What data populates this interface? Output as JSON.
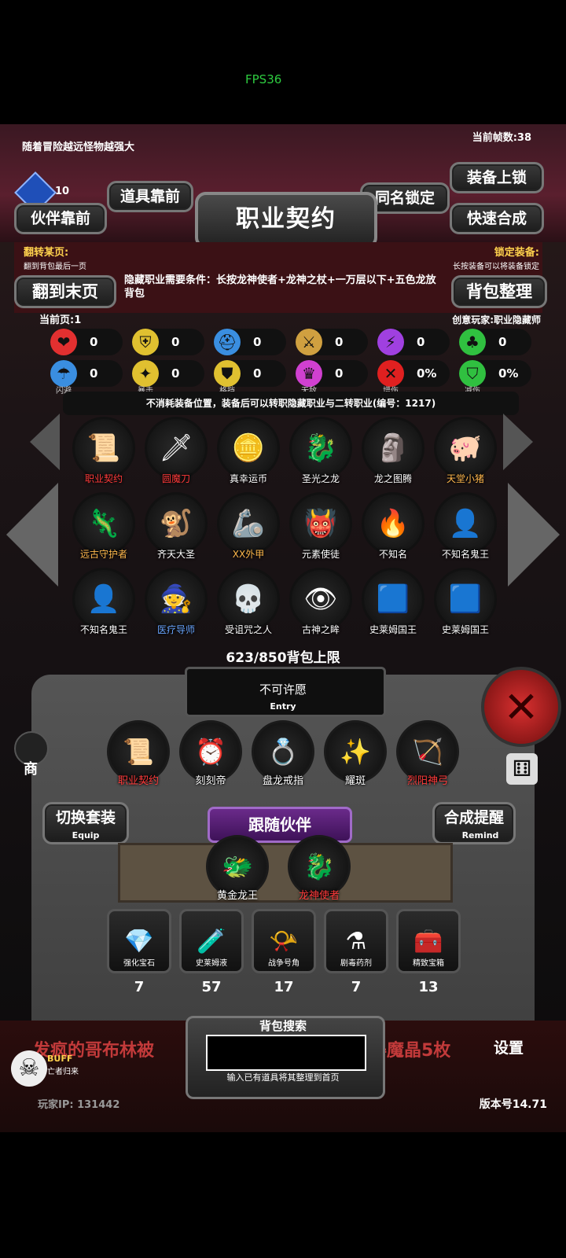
{
  "status_bar": {
    "fps": "FPS36"
  },
  "top": {
    "hint": "随着冒险越远怪物越强大",
    "frame_count": "当前帧数:38",
    "gem_count": "10"
  },
  "buttons": {
    "items_front": "道具靠前",
    "partner_front": "伙伴靠前",
    "same_name_lock": "同名锁定",
    "equip_lock": "装备上锁",
    "quick_synth": "快速合成",
    "goto_last": "翻到末页",
    "bag_sort": "背包整理"
  },
  "title": "职业契约",
  "panel": {
    "flip_title": "翻转某页:",
    "flip_sub": "翻到背包最后一页",
    "lock_title": "锁定装备:",
    "lock_sub": "长按装备可以将装备锁定",
    "hidden_req": "隐藏职业需要条件：长按龙神使者+龙神之杖+一万层以下+五色龙放背包",
    "current_page": "当前页:1",
    "creator": "创意玩家:职业隐藏师"
  },
  "stats_row1": [
    {
      "icon": "heart-icon",
      "glyph": "❤",
      "value": "0"
    },
    {
      "icon": "armor-icon",
      "glyph": "⛨",
      "value": "0"
    },
    {
      "icon": "helmet-icon",
      "glyph": "⛑",
      "value": "0"
    },
    {
      "icon": "sword-icon",
      "glyph": "⚔",
      "value": "0"
    },
    {
      "icon": "lightning-icon",
      "glyph": "⚡",
      "value": "0"
    },
    {
      "icon": "clover-icon",
      "glyph": "♣",
      "value": "0"
    }
  ],
  "stats_row2": [
    {
      "icon": "dodge-icon",
      "glyph": "☂",
      "value": "0",
      "label": "闪避"
    },
    {
      "icon": "crit-icon",
      "glyph": "✦",
      "value": "0",
      "label": "暴击"
    },
    {
      "icon": "block-icon",
      "glyph": "⛊",
      "value": "0",
      "label": "格挡"
    },
    {
      "icon": "invincible-icon",
      "glyph": "♛",
      "value": "0",
      "label": "无敌"
    },
    {
      "icon": "damage-up-icon",
      "glyph": "✕",
      "value": "0%",
      "label": "增伤"
    },
    {
      "icon": "damage-down-icon",
      "glyph": "⛉",
      "value": "0%",
      "label": "减伤"
    }
  ],
  "item_desc": "不消耗装备位置，装备后可以转职隐藏职业与二转职业(编号：1217)",
  "grid": [
    {
      "name": "职业契约",
      "glyph": "📜",
      "color": "red"
    },
    {
      "name": "圆魔刀",
      "glyph": "🗡",
      "color": "red"
    },
    {
      "name": "真幸运币",
      "glyph": "🪙",
      "color": "white"
    },
    {
      "name": "圣光之龙",
      "glyph": "🐉",
      "color": "white"
    },
    {
      "name": "龙之图腾",
      "glyph": "🗿",
      "color": "white"
    },
    {
      "name": "天堂小猪",
      "glyph": "🐖",
      "color": "orange"
    },
    {
      "name": "远古守护者",
      "glyph": "🦎",
      "color": "orange"
    },
    {
      "name": "齐天大圣",
      "glyph": "🐒",
      "color": "white"
    },
    {
      "name": "XX外甲",
      "glyph": "🦾",
      "color": "orange"
    },
    {
      "name": "元素使徒",
      "glyph": "👹",
      "color": "white"
    },
    {
      "name": "不知名",
      "glyph": "🔥",
      "color": "white"
    },
    {
      "name": "不知名鬼王",
      "glyph": "👤",
      "color": "white"
    },
    {
      "name": "不知名鬼王",
      "glyph": "👤",
      "color": "white"
    },
    {
      "name": "医疗导师",
      "glyph": "🧙",
      "color": "blue"
    },
    {
      "name": "受诅咒之人",
      "glyph": "💀",
      "color": "white"
    },
    {
      "name": "古神之眸",
      "glyph": "👁",
      "color": "white"
    },
    {
      "name": "史莱姆国王",
      "glyph": "🟦",
      "color": "white"
    },
    {
      "name": "史莱姆国王",
      "glyph": "🟦",
      "color": "white"
    }
  ],
  "bag_limit": "623/850背包上限",
  "entry": {
    "title": "不可许愿",
    "sub": "Entry"
  },
  "equipped": [
    {
      "name": "职业契约",
      "glyph": "📜",
      "color": "red"
    },
    {
      "name": "刻刻帝",
      "glyph": "⏰",
      "color": "white"
    },
    {
      "name": "盘龙戒指",
      "glyph": "💍",
      "color": "white"
    },
    {
      "name": "耀斑",
      "glyph": "✨",
      "color": "white"
    },
    {
      "name": "烈阳神弓",
      "glyph": "🏹",
      "color": "red"
    }
  ],
  "switch_set": {
    "label": "切换套装",
    "sub": "Equip"
  },
  "synth_remind": {
    "label": "合成提醒",
    "sub": "Remind"
  },
  "follow_partner": "跟随伙伴",
  "partners": [
    {
      "name": "黄金龙王",
      "glyph": "🐲"
    },
    {
      "name": "龙神使者",
      "glyph": "🐉"
    }
  ],
  "consumables": [
    {
      "name": "强化宝石",
      "glyph": "💎",
      "count": "7"
    },
    {
      "name": "史莱姆液",
      "glyph": "🧪",
      "count": "57"
    },
    {
      "name": "战争号角",
      "glyph": "📯",
      "count": "17"
    },
    {
      "name": "剧毒药剂",
      "glyph": "⚗",
      "count": "7"
    },
    {
      "name": "精致宝箱",
      "glyph": "🧰",
      "count": "13"
    }
  ],
  "search": {
    "title": "背包搜索",
    "hint": "输入已有道具将其整理到首页",
    "value": ""
  },
  "bottom": {
    "scroll_left": "发疯的哥布林被",
    "scroll_right": "得魔晶5枚",
    "buff": "BUFF",
    "buff_sub": "亡者归来",
    "player_ip": "玩家IP:  131442",
    "version": "版本号14.71",
    "settings": "设置",
    "shop": "商"
  }
}
